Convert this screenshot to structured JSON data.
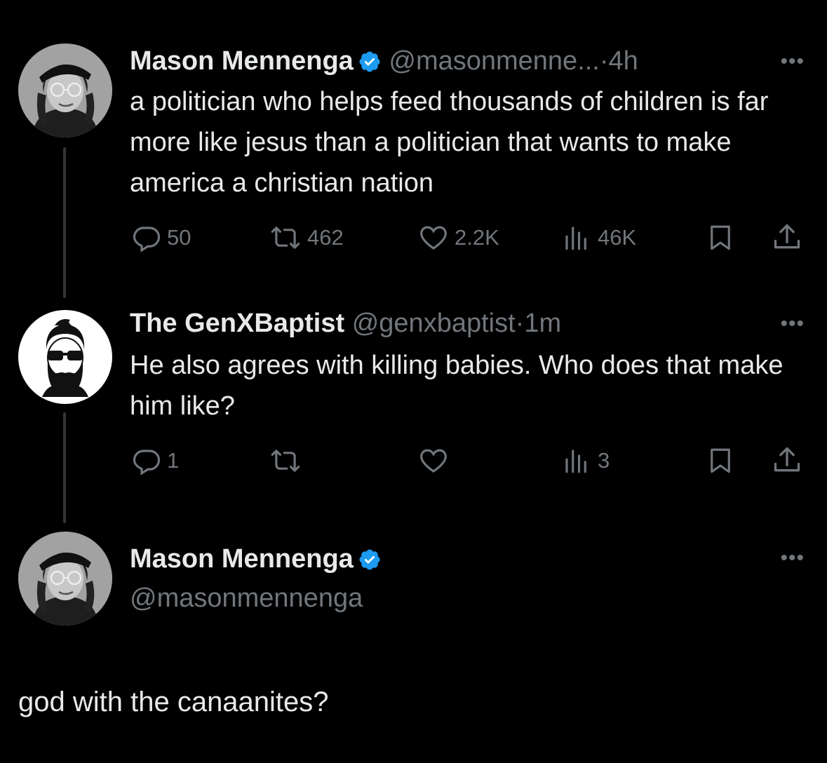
{
  "tweets": [
    {
      "name": "Mason Mennenga",
      "verified": true,
      "handle": "@masonmenne...",
      "separator": "·",
      "time": "4h",
      "text": "a politician who helps feed thousands of children is far more like jesus than a politician that wants to make america a christian nation",
      "stats": {
        "replies": "50",
        "reposts": "462",
        "likes": "2.2K",
        "views": "46K"
      }
    },
    {
      "name": "The GenXBaptist",
      "verified": false,
      "handle": "@genxbaptist",
      "separator": "·",
      "time": "1m",
      "text": "He also agrees with killing babies. Who does that make him like?",
      "stats": {
        "replies": "1",
        "reposts": "",
        "likes": "",
        "views": "3"
      }
    }
  ],
  "composer": {
    "name": "Mason Mennenga",
    "verified": true,
    "handle": "@masonmennenga",
    "text": "god with the canaanites?"
  },
  "more_label": "•••",
  "colors": {
    "background": "#000000",
    "primary_text": "#e7e9ea",
    "secondary_text": "#71767b",
    "verified_blue": "#1d9bf0",
    "thread_line": "#333639"
  },
  "icons": [
    "more-icon",
    "verified-badge-icon",
    "reply-icon",
    "repost-icon",
    "like-icon",
    "views-icon",
    "bookmark-icon",
    "share-icon"
  ]
}
